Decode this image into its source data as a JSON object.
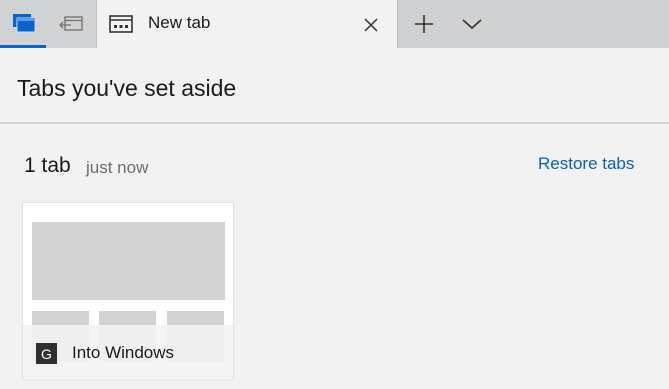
{
  "tabbar": {
    "tab": {
      "title": "New tab"
    }
  },
  "panel": {
    "title": "Tabs you've set aside"
  },
  "group": {
    "count_label": "1 tab",
    "time_label": "just now",
    "restore_label": "Restore tabs"
  },
  "card": {
    "favicon_letter": "G",
    "title": "Into Windows"
  },
  "colors": {
    "accent": "#0a63c9",
    "link": "#1060b0"
  },
  "icons": [
    "tabs-aside-icon",
    "set-aside-icon",
    "new-tab-page-icon",
    "close-icon",
    "plus-icon",
    "chevron-down-icon"
  ]
}
